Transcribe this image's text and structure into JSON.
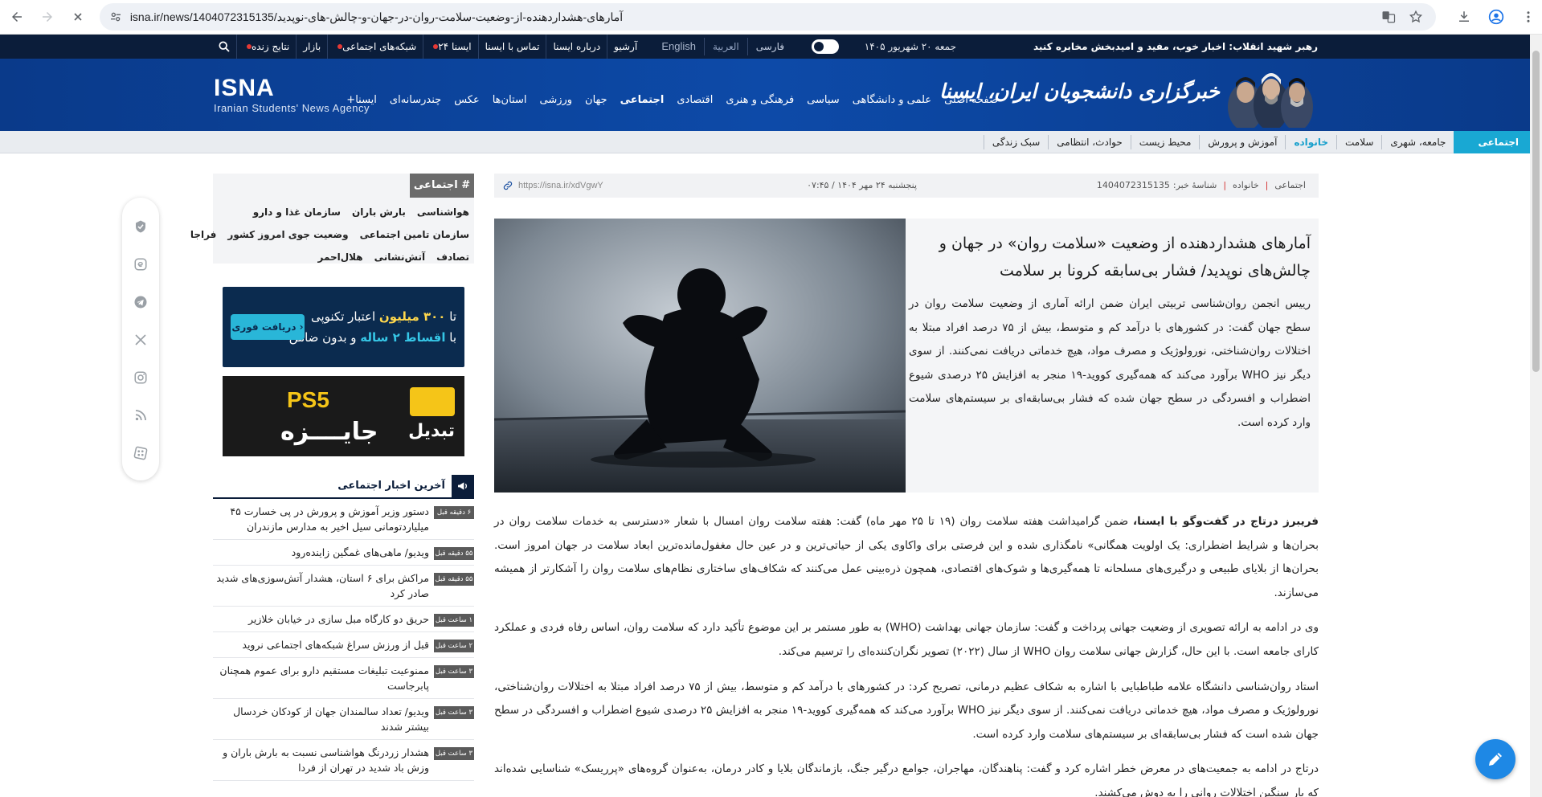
{
  "browser": {
    "url": "isna.ir/news/1404072315135/آمارهای-هشداردهنده-از-وضعیت-سلامت-روان-در-جهان-و-چالش-های-نوپدید"
  },
  "topbar": {
    "motto": "رهبر شهید انقلاب: اخبار خوب، مفید و امیدبخش مخابره کنید",
    "date": "جمعه ۲۰ شهریور ۱۴۰۵",
    "languages": [
      "فارسی",
      "العربية",
      "English"
    ],
    "links": [
      {
        "label": "آرشیو",
        "dot": false
      },
      {
        "label": "درباره ایسنا",
        "dot": false
      },
      {
        "label": "تماس با ایسنا",
        "dot": false
      },
      {
        "label": "ایسنا ۲۴",
        "dot": true
      },
      {
        "label": "شبکه‌های اجتماعی",
        "dot": true
      },
      {
        "label": "بازار",
        "dot": false
      },
      {
        "label": "نتایج زنده",
        "dot": true
      }
    ]
  },
  "header": {
    "logo": "ISNA",
    "logo_sub": "Iranian Students' News Agency",
    "brand_fa": "خبرگزاری دانشجویان ایران، ایسنا",
    "nav": [
      "صفحه اصلی",
      "علمی و دانشگاهی",
      "سیاسی",
      "فرهنگی و هنری",
      "اقتصادی",
      "اجتماعی",
      "جهان",
      "ورزشی",
      "استان‌ها",
      "عکس",
      "چندرسانه‌ای",
      "ایسنا+"
    ],
    "active_nav": "اجتماعی"
  },
  "subnav": {
    "category": "اجتماعی",
    "items": [
      "جامعه، شهری",
      "سلامت",
      "خانواده",
      "آموزش و پرورش",
      "محیط زیست",
      "حوادث، انتظامی",
      "سبک زندگی"
    ],
    "highlight": "خانواده"
  },
  "article": {
    "meta": {
      "category": "اجتماعی",
      "subcategory": "خانواده",
      "news_id_label": "شناسهٔ خبر:",
      "news_id": "1404072315135",
      "date": "پنجشنبه ۲۴ مهر ۱۴۰۴ / ۰۷:۴۵",
      "short_link": "https://isna.ir/xdVgwY"
    },
    "title": "آمارهای هشداردهنده از وضعیت «سلامت روان» در جهان و چالش‌های نوپدید/ فشار بی‌سابقه کرونا بر سلامت",
    "lead": "رییس انجمن روان‌شناسی تربیتی ایران ضمن ارائه آماری از وضعیت سلامت روان در سطح جهان گفت: در کشورهای با درآمد کم و متوسط، بیش از ۷۵ درصد افراد مبتلا به اختلالات روان‌شناختی، نورولوژیک و مصرف مواد، هیچ خدماتی دریافت نمی‌کنند. از سوی دیگر نیز WHO برآورد می‌کند که همه‌گیری کووید-۱۹ منجر به افزایش ۲۵ درصدی شیوع اضطراب و افسردگی در سطح جهان شده که فشار بی‌سابقه‌ای بر سیستم‌های سلامت وارد کرده است.",
    "p1_bold": "فریبرز درتاج در گفت‌وگو با ایسنا،",
    "p1": " ضمن گرامیداشت هفته سلامت روان (۱۹ تا ۲۵ مهر ماه) گفت: هفته سلامت روان امسال با شعار «دسترسی به خدمات سلامت روان در بحران‌ها و شرایط اضطراری: یک اولویت همگانی» نامگذاری شده و این فرصتی برای واکاوی یکی از حیاتی‌ترین و در عین حال مغفول‌مانده‌ترین ابعاد سلامت در جهان امروز است. بحران‌ها از بلایای طبیعی و درگیری‌های مسلحانه تا همه‌گیری‌ها و شوک‌های اقتصادی، همچون ذره‌بینی عمل می‌کنند که شکاف‌های ساختاری نظام‌های سلامت روان را آشکارتر از همیشه می‌سازند.",
    "p2": "وی در ادامه به ارائه تصویری از وضعیت جهانی پرداخت و گفت: سازمان جهانی بهداشت (WHO) به طور مستمر بر این موضوع تأکید دارد که سلامت روان، اساس رفاه فردی و عملکرد کارای جامعه است. با این حال، گزارش جهانی سلامت روان WHO از سال (۲۰۲۲) تصویر نگران‌کننده‌ای را ترسیم می‌کند.",
    "p3": "استاد روان‌شناسی دانشگاه علامه طباطبایی با اشاره به شکاف عظیم درمانی، تصریح کرد: در کشورهای با درآمد کم و متوسط، بیش از ۷۵ درصد افراد مبتلا به اختلالات روان‌شناختی، نورولوژیک و مصرف مواد، هیچ خدماتی دریافت نمی‌کنند. از سوی دیگر نیز WHO برآورد می‌کند که همه‌گیری کووید-۱۹ منجر به افزایش ۲۵ درصدی شیوع اضطراب و افسردگی در سطح جهان شده است که فشار بی‌سابقه‌ای بر سیستم‌های سلامت وارد کرده است.",
    "p4": "درتاج در ادامه به جمعیت‌های در معرض خطر اشاره کرد و گفت: پناهندگان، مهاجران، جوامع درگیر جنگ، بازماندگان بلایا و کادر درمان، به‌عنوان گروه‌های «پرریسک» شناسایی شده‌اند که بار سنگین اختلالات روانی را به دوش می‌کشند."
  },
  "sidebar": {
    "tags_title": "# اجتماعی",
    "tag_rows": [
      [
        "هواشناسی",
        "بارش باران",
        "سازمان غذا و دارو"
      ],
      [
        "سازمان تامین اجتماعی",
        "وضعیت جوی امروز کشور",
        "فراجا"
      ],
      [
        "تصادف",
        "آتش‌نشانی",
        "هلال‌احمر"
      ]
    ],
    "ad1": {
      "line1_a": "تا",
      "line1_b": "۳۰۰ میلیون",
      "line1_c": "اعتبار تکنوپی",
      "line2_a": "با",
      "line2_b": "اقساط ۲ ساله",
      "line2_c": "و بدون ضامن",
      "button": "دریافت فوری"
    },
    "ad2": {
      "ps5": "PS5",
      "prize": "جایــــزه",
      "brand": "تبدیل"
    },
    "latest_title": "آخرین اخبار اجتماعی",
    "latest": [
      {
        "time": "۶ دقیقه قبل",
        "title": "دستور وزیر آموزش و پرورش در پی خسارت ۴۵ میلیاردتومانی سیل اخیر به مدارس مازندران"
      },
      {
        "time": "۵۵ دقیقه قبل",
        "title": "ویدیو/ ماهی‌های غمگین زاینده‌رود"
      },
      {
        "time": "۵۵ دقیقه قبل",
        "title": "مراکش برای ۶ استان، هشدار آتش‌سوزی‌های شدید صادر کرد"
      },
      {
        "time": "۱ ساعت قبل",
        "title": "حریق دو کارگاه مبل سازی در خیابان خلازیر"
      },
      {
        "time": "۲ ساعت قبل",
        "title": "قبل از ورزش سراغ شبکه‌های اجتماعی نروید"
      },
      {
        "time": "۳ ساعت قبل",
        "title": "ممنوعیت تبلیغات مستقیم دارو برای عموم همچنان پابرجاست"
      },
      {
        "time": "۳ ساعت قبل",
        "title": "ویدیو/ تعداد سالمندان جهان از کودکان خردسال بیشتر شدند"
      },
      {
        "time": "۳ ساعت قبل",
        "title": "هشدار زردرنگ هواشناسی نسبت به بارش باران و وزش باد شدید در تهران از فردا"
      }
    ]
  }
}
